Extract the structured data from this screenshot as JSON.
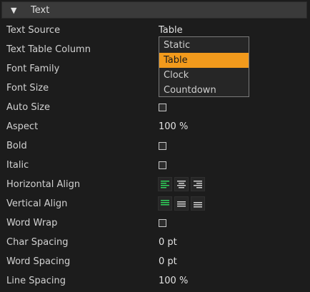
{
  "section": {
    "title": "Text",
    "toggle_icon": "triangle-down-icon"
  },
  "properties": {
    "text_source": {
      "label": "Text Source",
      "value": "Table"
    },
    "text_table_column": {
      "label": "Text Table Column"
    },
    "font_family": {
      "label": "Font Family"
    },
    "font_size": {
      "label": "Font Size"
    },
    "auto_size": {
      "label": "Auto Size",
      "checked": false
    },
    "aspect": {
      "label": "Aspect",
      "value": "100 %"
    },
    "bold": {
      "label": "Bold",
      "checked": false
    },
    "italic": {
      "label": "Italic",
      "checked": false
    },
    "horizontal_align": {
      "label": "Horizontal Align",
      "options": [
        "left",
        "center",
        "right"
      ],
      "selected": "left"
    },
    "vertical_align": {
      "label": "Vertical Align",
      "options": [
        "top",
        "middle",
        "bottom"
      ],
      "selected": "top"
    },
    "word_wrap": {
      "label": "Word Wrap",
      "checked": false
    },
    "char_spacing": {
      "label": "Char Spacing",
      "value": "0 pt"
    },
    "word_spacing": {
      "label": "Word Spacing",
      "value": "0 pt"
    },
    "line_spacing": {
      "label": "Line Spacing",
      "value": "100 %"
    }
  },
  "text_source_dropdown": {
    "options": [
      "Static",
      "Table",
      "Clock",
      "Countdown"
    ],
    "selected": "Table"
  },
  "colors": {
    "background": "#1c1c1c",
    "header": "#3a3a3a",
    "accent_selected": "#f29a1c",
    "align_active": "#2fd35a",
    "align_inactive": "#d0d0d0"
  }
}
